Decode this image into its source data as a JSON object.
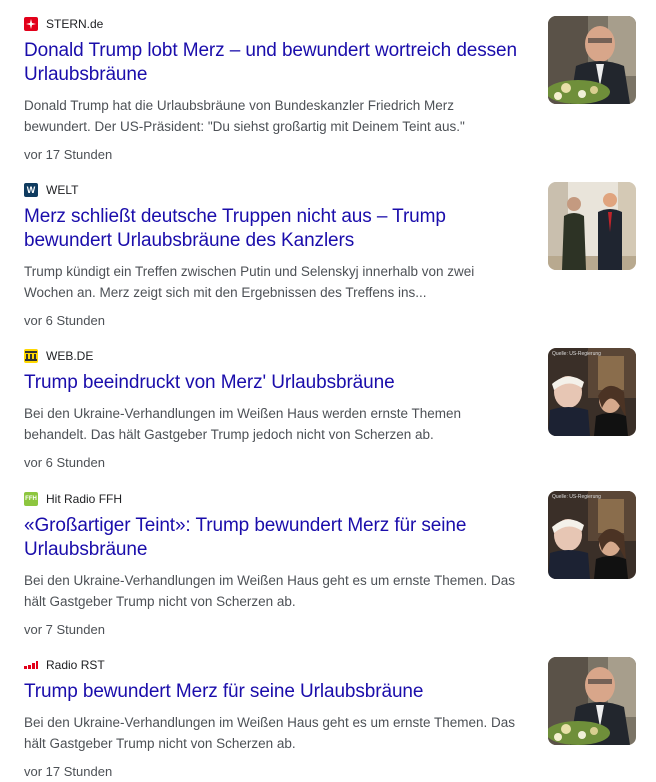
{
  "articles": [
    {
      "source": "STERN.de",
      "favicon_color": "#e2001a",
      "title": "Donald Trump lobt Merz – und bewundert wortreich dessen Urlaubsbräune",
      "snippet": "Donald Trump hat die Urlaubsbräune von Bundeskanzler Friedrich Merz bewundert. Der US-Präsident: \"Du siehst großartig mit Deinem Teint aus.\"",
      "time": "vor 17 Stunden",
      "thumb_icon": "man-portrait-flowers-thumbnail"
    },
    {
      "source": "WELT",
      "favicon_color": "#0f3b5f",
      "title": "Merz schließt deutsche Truppen nicht aus – Trump bewundert Urlaubsbräune des Kanzlers",
      "snippet": "Trump kündigt ein Treffen zwischen Putin und Selenskyj innerhalb von zwei Wochen an. Merz zeigt sich mit den Ergebnissen des Treffens ins...",
      "time": "vor 6 Stunden",
      "thumb_icon": "two-men-walking-thumbnail"
    },
    {
      "source": "WEB.DE",
      "favicon_color": "#ffd800",
      "title": "Trump beeindruckt von Merz' Urlaubsbräune",
      "snippet": "Bei den Ukraine-Verhandlungen im Weißen Haus werden ernste Themen behandelt. Das hält Gastgeber Trump jedoch nicht von Scherzen ab.",
      "time": "vor 6 Stunden",
      "thumb_icon": "meeting-room-thumbnail",
      "thumb_caption": "Quelle: US-Regierung"
    },
    {
      "source": "Hit Radio FFH",
      "favicon_color": "#8dc63f",
      "title": "«Großartiger Teint»: Trump bewundert Merz für seine Urlaubsbräune",
      "snippet": "Bei den Ukraine-Verhandlungen im Weißen Haus geht es um ernste Themen. Das hält Gastgeber Trump nicht von Scherzen ab.",
      "time": "vor 7 Stunden",
      "thumb_icon": "meeting-room-thumbnail",
      "thumb_caption": "Quelle: US-Regierung"
    },
    {
      "source": "Radio RST",
      "favicon_color": "#e2001a",
      "title": "Trump bewundert Merz für seine Urlaubsbräune",
      "snippet": "Bei den Ukraine-Verhandlungen im Weißen Haus geht es um ernste Themen. Das hält Gastgeber Trump nicht von Scherzen ab.",
      "time": "vor 17 Stunden",
      "thumb_icon": "man-portrait-flowers-thumbnail"
    }
  ]
}
